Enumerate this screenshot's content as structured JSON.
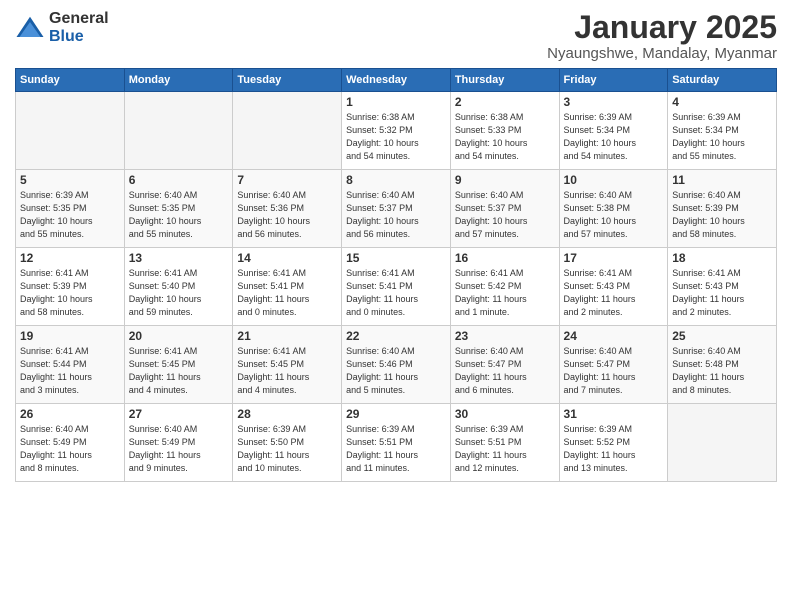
{
  "logo": {
    "general": "General",
    "blue": "Blue"
  },
  "header": {
    "month": "January 2025",
    "location": "Nyaungshwe, Mandalay, Myanmar"
  },
  "weekdays": [
    "Sunday",
    "Monday",
    "Tuesday",
    "Wednesday",
    "Thursday",
    "Friday",
    "Saturday"
  ],
  "weeks": [
    [
      {
        "day": "",
        "info": ""
      },
      {
        "day": "",
        "info": ""
      },
      {
        "day": "",
        "info": ""
      },
      {
        "day": "1",
        "info": "Sunrise: 6:38 AM\nSunset: 5:32 PM\nDaylight: 10 hours\nand 54 minutes."
      },
      {
        "day": "2",
        "info": "Sunrise: 6:38 AM\nSunset: 5:33 PM\nDaylight: 10 hours\nand 54 minutes."
      },
      {
        "day": "3",
        "info": "Sunrise: 6:39 AM\nSunset: 5:34 PM\nDaylight: 10 hours\nand 54 minutes."
      },
      {
        "day": "4",
        "info": "Sunrise: 6:39 AM\nSunset: 5:34 PM\nDaylight: 10 hours\nand 55 minutes."
      }
    ],
    [
      {
        "day": "5",
        "info": "Sunrise: 6:39 AM\nSunset: 5:35 PM\nDaylight: 10 hours\nand 55 minutes."
      },
      {
        "day": "6",
        "info": "Sunrise: 6:40 AM\nSunset: 5:35 PM\nDaylight: 10 hours\nand 55 minutes."
      },
      {
        "day": "7",
        "info": "Sunrise: 6:40 AM\nSunset: 5:36 PM\nDaylight: 10 hours\nand 56 minutes."
      },
      {
        "day": "8",
        "info": "Sunrise: 6:40 AM\nSunset: 5:37 PM\nDaylight: 10 hours\nand 56 minutes."
      },
      {
        "day": "9",
        "info": "Sunrise: 6:40 AM\nSunset: 5:37 PM\nDaylight: 10 hours\nand 57 minutes."
      },
      {
        "day": "10",
        "info": "Sunrise: 6:40 AM\nSunset: 5:38 PM\nDaylight: 10 hours\nand 57 minutes."
      },
      {
        "day": "11",
        "info": "Sunrise: 6:40 AM\nSunset: 5:39 PM\nDaylight: 10 hours\nand 58 minutes."
      }
    ],
    [
      {
        "day": "12",
        "info": "Sunrise: 6:41 AM\nSunset: 5:39 PM\nDaylight: 10 hours\nand 58 minutes."
      },
      {
        "day": "13",
        "info": "Sunrise: 6:41 AM\nSunset: 5:40 PM\nDaylight: 10 hours\nand 59 minutes."
      },
      {
        "day": "14",
        "info": "Sunrise: 6:41 AM\nSunset: 5:41 PM\nDaylight: 11 hours\nand 0 minutes."
      },
      {
        "day": "15",
        "info": "Sunrise: 6:41 AM\nSunset: 5:41 PM\nDaylight: 11 hours\nand 0 minutes."
      },
      {
        "day": "16",
        "info": "Sunrise: 6:41 AM\nSunset: 5:42 PM\nDaylight: 11 hours\nand 1 minute."
      },
      {
        "day": "17",
        "info": "Sunrise: 6:41 AM\nSunset: 5:43 PM\nDaylight: 11 hours\nand 2 minutes."
      },
      {
        "day": "18",
        "info": "Sunrise: 6:41 AM\nSunset: 5:43 PM\nDaylight: 11 hours\nand 2 minutes."
      }
    ],
    [
      {
        "day": "19",
        "info": "Sunrise: 6:41 AM\nSunset: 5:44 PM\nDaylight: 11 hours\nand 3 minutes."
      },
      {
        "day": "20",
        "info": "Sunrise: 6:41 AM\nSunset: 5:45 PM\nDaylight: 11 hours\nand 4 minutes."
      },
      {
        "day": "21",
        "info": "Sunrise: 6:41 AM\nSunset: 5:45 PM\nDaylight: 11 hours\nand 4 minutes."
      },
      {
        "day": "22",
        "info": "Sunrise: 6:40 AM\nSunset: 5:46 PM\nDaylight: 11 hours\nand 5 minutes."
      },
      {
        "day": "23",
        "info": "Sunrise: 6:40 AM\nSunset: 5:47 PM\nDaylight: 11 hours\nand 6 minutes."
      },
      {
        "day": "24",
        "info": "Sunrise: 6:40 AM\nSunset: 5:47 PM\nDaylight: 11 hours\nand 7 minutes."
      },
      {
        "day": "25",
        "info": "Sunrise: 6:40 AM\nSunset: 5:48 PM\nDaylight: 11 hours\nand 8 minutes."
      }
    ],
    [
      {
        "day": "26",
        "info": "Sunrise: 6:40 AM\nSunset: 5:49 PM\nDaylight: 11 hours\nand 8 minutes."
      },
      {
        "day": "27",
        "info": "Sunrise: 6:40 AM\nSunset: 5:49 PM\nDaylight: 11 hours\nand 9 minutes."
      },
      {
        "day": "28",
        "info": "Sunrise: 6:39 AM\nSunset: 5:50 PM\nDaylight: 11 hours\nand 10 minutes."
      },
      {
        "day": "29",
        "info": "Sunrise: 6:39 AM\nSunset: 5:51 PM\nDaylight: 11 hours\nand 11 minutes."
      },
      {
        "day": "30",
        "info": "Sunrise: 6:39 AM\nSunset: 5:51 PM\nDaylight: 11 hours\nand 12 minutes."
      },
      {
        "day": "31",
        "info": "Sunrise: 6:39 AM\nSunset: 5:52 PM\nDaylight: 11 hours\nand 13 minutes."
      },
      {
        "day": "",
        "info": ""
      }
    ]
  ]
}
